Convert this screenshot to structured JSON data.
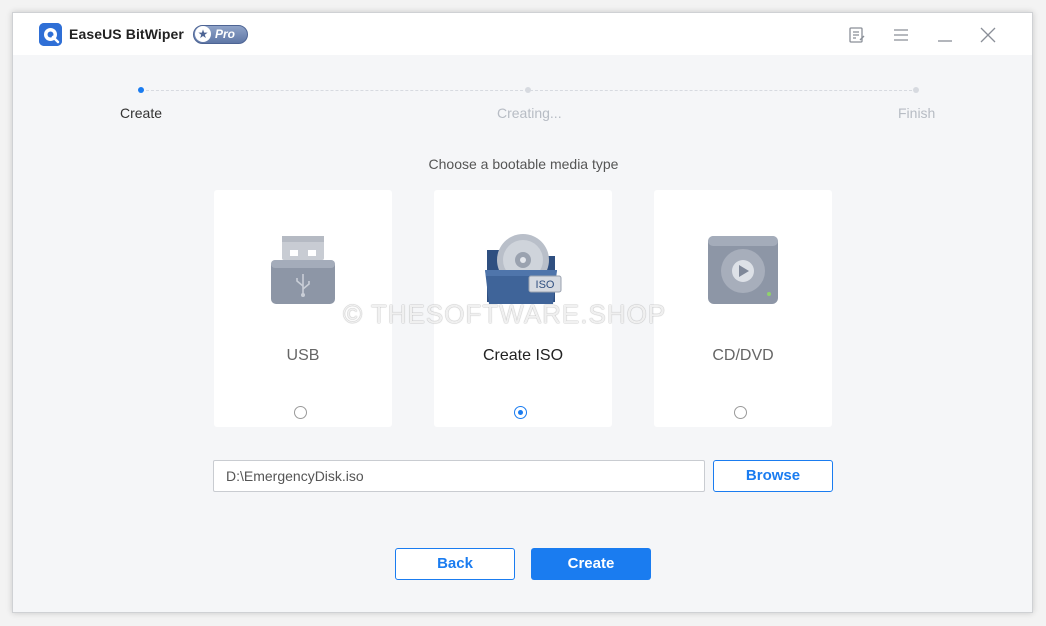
{
  "app": {
    "title": "EaseUS BitWiper",
    "badge": "Pro"
  },
  "titlebar": {
    "icons": [
      "feedback-icon",
      "menu-icon",
      "minimize-icon",
      "close-icon"
    ]
  },
  "steps": [
    {
      "label": "Create",
      "state": "active"
    },
    {
      "label": "Creating...",
      "state": "inactive"
    },
    {
      "label": "Finish",
      "state": "inactive"
    }
  ],
  "main": {
    "prompt": "Choose a bootable media type",
    "options": [
      {
        "label": "USB",
        "icon": "usb-drive-icon",
        "selected": false
      },
      {
        "label": "Create ISO",
        "icon": "iso-disc-folder-icon",
        "selected": true
      },
      {
        "label": "CD/DVD",
        "icon": "cd-dvd-drive-icon",
        "selected": false
      }
    ],
    "path_value": "D:\\EmergencyDisk.iso",
    "browse_label": "Browse"
  },
  "footer": {
    "back_label": "Back",
    "create_label": "Create"
  },
  "watermark": "© THESOFTWARE.SHOP",
  "colors": {
    "accent": "#1a7cf0",
    "inactive_step": "#b7bcc4"
  }
}
